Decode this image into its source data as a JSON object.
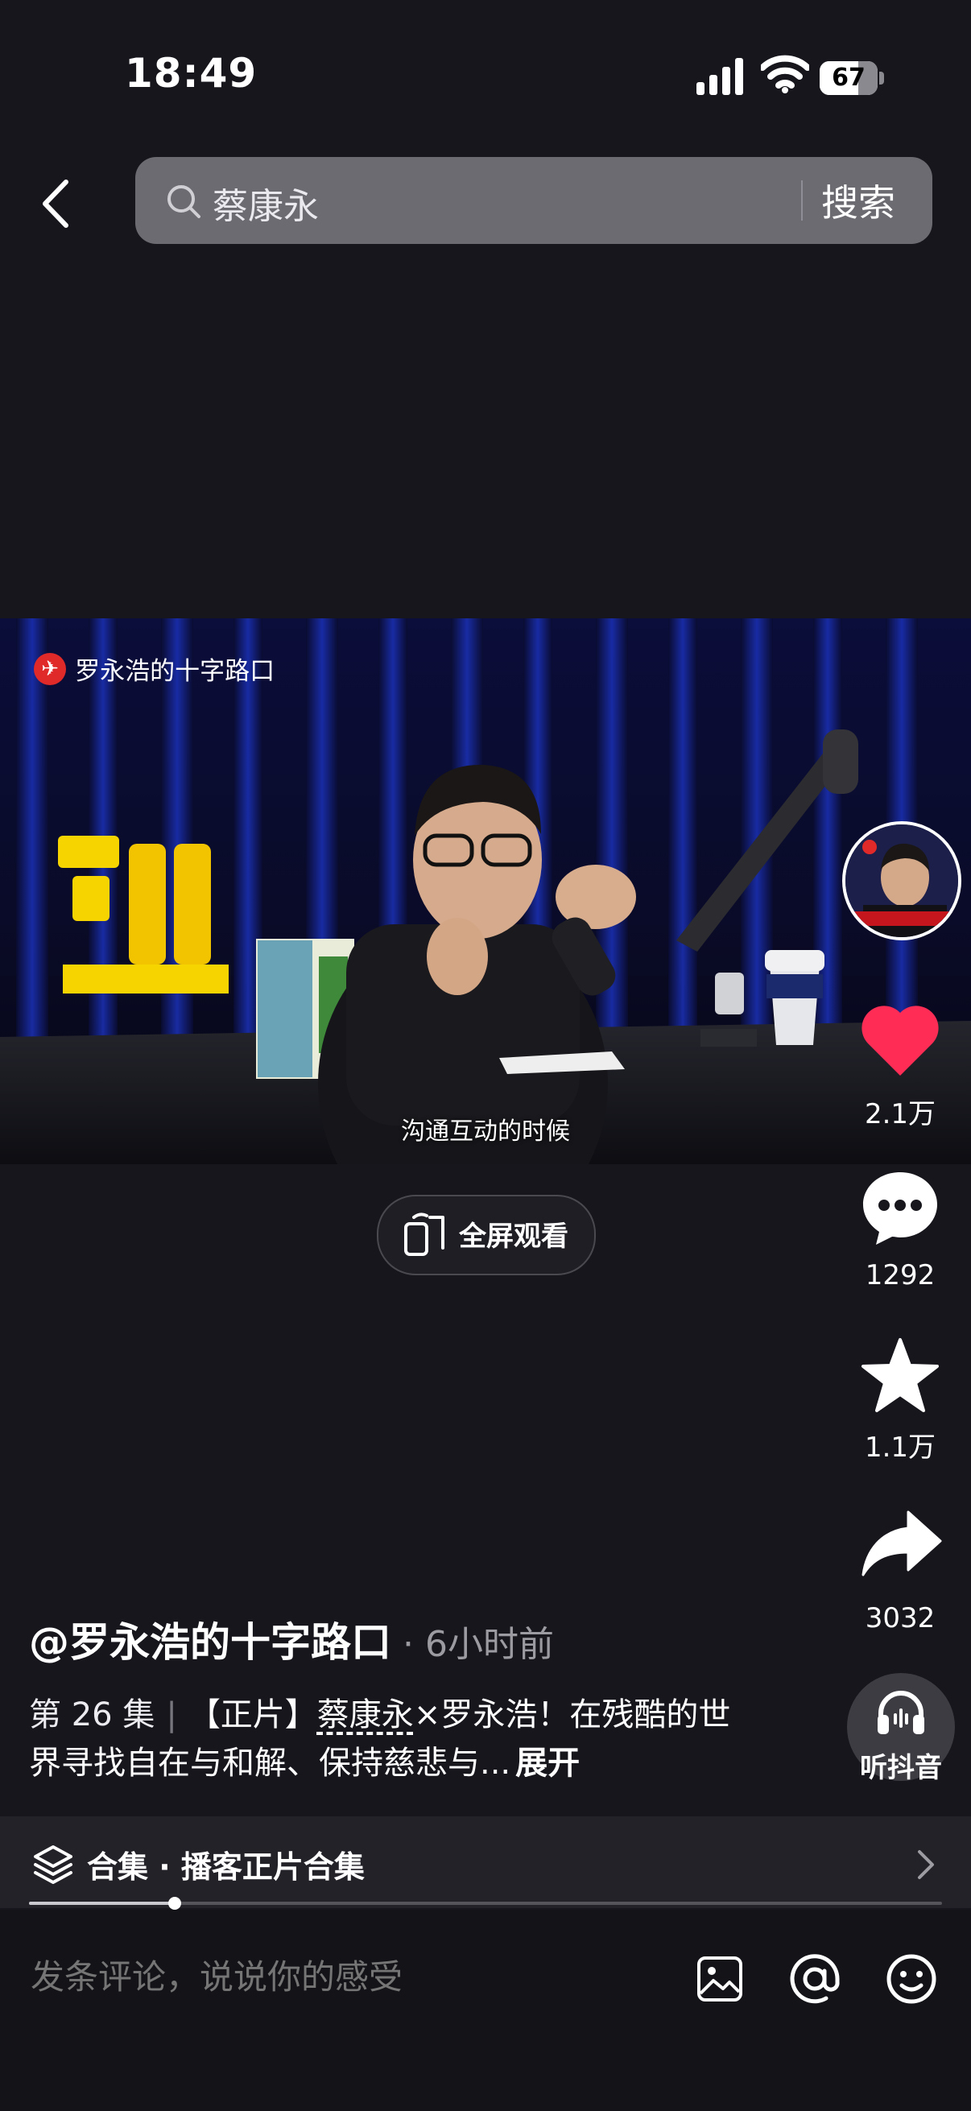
{
  "status_bar": {
    "time": "18:49",
    "battery": "67",
    "battery_level": 0.67
  },
  "search": {
    "query": "蔡康永",
    "button": "搜索"
  },
  "video": {
    "channel_watermark": "罗永浩的十字路口",
    "subtitle": "沟通互动的时候",
    "fullscreen_label": "全屏观看"
  },
  "actions": {
    "likes": "2.1万",
    "comments": "1292",
    "favorites": "1.1万",
    "shares": "3032",
    "listen_label": "听抖音"
  },
  "post": {
    "author": "@罗永浩的十字路口",
    "time": "· 6小时前",
    "episode": "第 26 集",
    "desc_prefix": "【正片】",
    "desc_tag": "蔡康永",
    "desc_rest": "×罗永浩！在残酷的世界寻找自在与和解、保持慈悲与...",
    "expand": "展开"
  },
  "collection": {
    "label": "合集 · 播客正片合集",
    "progress": 0.16
  },
  "comment": {
    "placeholder": "发条评论，说说你的感受"
  },
  "colors": {
    "background": "#17161d",
    "like_red": "#ff2c55",
    "search_bg": "#6c6b72"
  }
}
